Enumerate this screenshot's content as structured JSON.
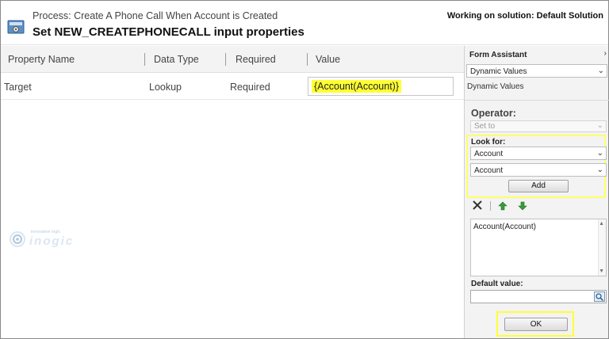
{
  "header": {
    "process_line": "Process: Create A Phone Call When Account is Created",
    "title": "Set NEW_CREATEPHONECALL input properties",
    "solution": "Working on solution: Default Solution"
  },
  "grid": {
    "columns": [
      "Property Name",
      "Data Type",
      "Required",
      "Value"
    ],
    "rows": [
      {
        "property_name": "Target",
        "data_type": "Lookup",
        "required": "Required",
        "value": "{Account(Account)}"
      }
    ]
  },
  "watermark": {
    "tagline": "innovative logic",
    "brand": "inogic"
  },
  "panel": {
    "title": "Form Assistant",
    "collapse_icon": "chevron-right-icon",
    "mode_select": "Dynamic Values",
    "subheading": "Dynamic Values",
    "operator_label": "Operator:",
    "operator_value": "Set to",
    "look_for_label": "Look for:",
    "look_for_entity": "Account",
    "look_for_field": "Account",
    "add_label": "Add",
    "selected_value": "Account(Account)",
    "default_value_label": "Default value:",
    "default_value": "",
    "ok_label": "OK"
  },
  "colors": {
    "highlight": "#ffff33",
    "up_arrow": "#3a9a3a",
    "down_arrow": "#3a9a3a"
  }
}
